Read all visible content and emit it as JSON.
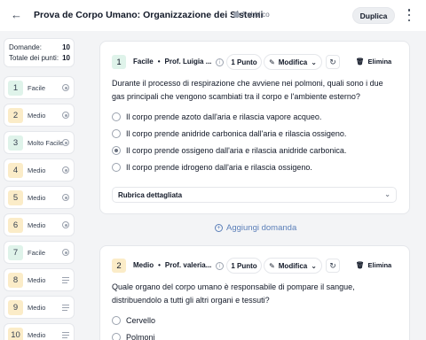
{
  "header": {
    "back_icon": "arrow-left-icon",
    "title": "Prova de Corpo Umano: Organizzazione dei Sistemi",
    "status": "Pubblico",
    "duplicate_label": "Duplica",
    "more_icon": "kebab-menu-icon"
  },
  "sidebar": {
    "domande_label": "Domande:",
    "domande_value": "10",
    "punti_label": "Totale dei punti:",
    "punti_value": "10",
    "items": [
      {
        "num": "1",
        "difficulty": "Facile",
        "type": "radio"
      },
      {
        "num": "2",
        "difficulty": "Medio",
        "type": "radio"
      },
      {
        "num": "3",
        "difficulty": "Molto Facile",
        "type": "radio"
      },
      {
        "num": "4",
        "difficulty": "Medio",
        "type": "radio"
      },
      {
        "num": "5",
        "difficulty": "Medio",
        "type": "radio"
      },
      {
        "num": "6",
        "difficulty": "Medio",
        "type": "radio"
      },
      {
        "num": "7",
        "difficulty": "Facile",
        "type": "radio"
      },
      {
        "num": "8",
        "difficulty": "Medio",
        "type": "text"
      },
      {
        "num": "9",
        "difficulty": "Medio",
        "type": "text"
      },
      {
        "num": "10",
        "difficulty": "Medio",
        "type": "text"
      }
    ]
  },
  "questions": [
    {
      "num": "1",
      "difficulty": "Facile",
      "author": "Prof. Luigia ...",
      "points": "1 Punto",
      "edit_label": "Modifica",
      "delete_label": "Elimina",
      "text": "Durante il processo di respirazione che avviene nei polmoni, quali sono i due gas principali che vengono scambiati tra il corpo e l'ambiente esterno?",
      "options": [
        "Il corpo prende azoto dall'aria e rilascia vapore acqueo.",
        "Il corpo prende anidride carbonica dall'aria e rilascia ossigeno.",
        "Il corpo prende ossigeno dall'aria e rilascia anidride carbonica.",
        "Il corpo prende idrogeno dall'aria e rilascia ossigeno."
      ],
      "selected_option": 2,
      "rubric_label": "Rubrica dettagliata"
    },
    {
      "num": "2",
      "difficulty": "Medio",
      "author": "Prof. valeria...",
      "points": "1 Punto",
      "edit_label": "Modifica",
      "delete_label": "Elimina",
      "text": "Quale organo del corpo umano è responsabile di pompare il sangue, distribuendolo a tutti gli altri organi e tessuti?",
      "options": [
        "Cervello",
        "Polmoni"
      ]
    }
  ],
  "add_question_label": "Aggiungi domanda",
  "colors": {
    "easy_badge": "#dff3ea",
    "medium_badge": "#fbecc8",
    "link": "#5b7fb9"
  }
}
